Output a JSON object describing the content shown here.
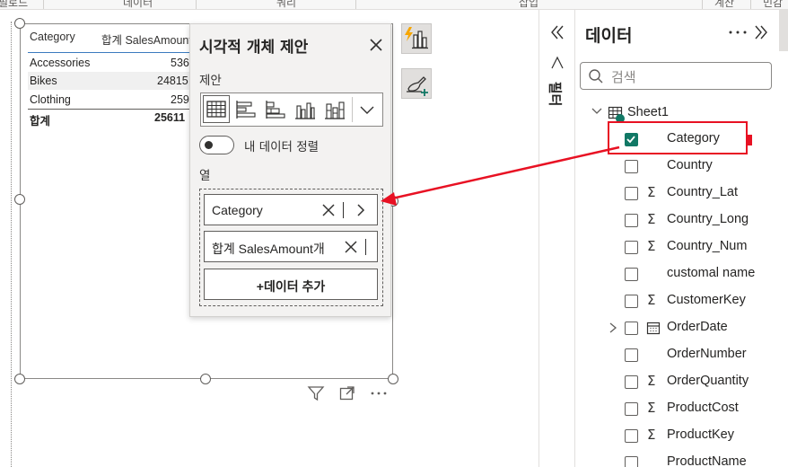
{
  "ribbon": {
    "groups": [
      "필로드",
      "데이터",
      "쿼리",
      "삽입",
      "계산",
      "민감"
    ]
  },
  "table_visual": {
    "headers": {
      "category": "Category",
      "amount": "합계 SalesAmount"
    },
    "rows": [
      {
        "category": "Accessories",
        "amount": "536"
      },
      {
        "category": "Bikes",
        "amount": "24815"
      },
      {
        "category": "Clothing",
        "amount": "259"
      }
    ],
    "total": {
      "label": "합계",
      "amount": "25611"
    }
  },
  "popup": {
    "title": "시각적 개체 제안",
    "suggestions_label": "제안",
    "toggle_label": "내 데이터 정렬",
    "columns_label": "열",
    "fields": [
      {
        "label": "Category"
      },
      {
        "label": "합계 SalesAmount개"
      }
    ],
    "add_button": "+데이터 추가"
  },
  "filters_pane": {
    "label": "필터"
  },
  "data_pane": {
    "title": "데이터",
    "search_placeholder": "검색",
    "table_name": "Sheet1",
    "fields": [
      {
        "label": "Category",
        "checked": true,
        "sigma": false,
        "icon": ""
      },
      {
        "label": "Country",
        "checked": false,
        "sigma": false,
        "icon": ""
      },
      {
        "label": "Country_Lat",
        "checked": false,
        "sigma": true,
        "icon": ""
      },
      {
        "label": "Country_Long",
        "checked": false,
        "sigma": true,
        "icon": ""
      },
      {
        "label": "Country_Num",
        "checked": false,
        "sigma": true,
        "icon": ""
      },
      {
        "label": "customal name",
        "checked": false,
        "sigma": false,
        "icon": ""
      },
      {
        "label": "CustomerKey",
        "checked": false,
        "sigma": true,
        "icon": ""
      },
      {
        "label": "OrderDate",
        "checked": false,
        "sigma": false,
        "icon": "calendar-icon"
      },
      {
        "label": "OrderNumber",
        "checked": false,
        "sigma": false,
        "icon": ""
      },
      {
        "label": "OrderQuantity",
        "checked": false,
        "sigma": true,
        "icon": ""
      },
      {
        "label": "ProductCost",
        "checked": false,
        "sigma": true,
        "icon": ""
      },
      {
        "label": "ProductKey",
        "checked": false,
        "sigma": true,
        "icon": ""
      },
      {
        "label": "ProductName",
        "checked": false,
        "sigma": false,
        "icon": ""
      }
    ]
  },
  "colors": {
    "accent": "#117865",
    "annotation": "#e81123",
    "lightning": "#f7a600"
  }
}
